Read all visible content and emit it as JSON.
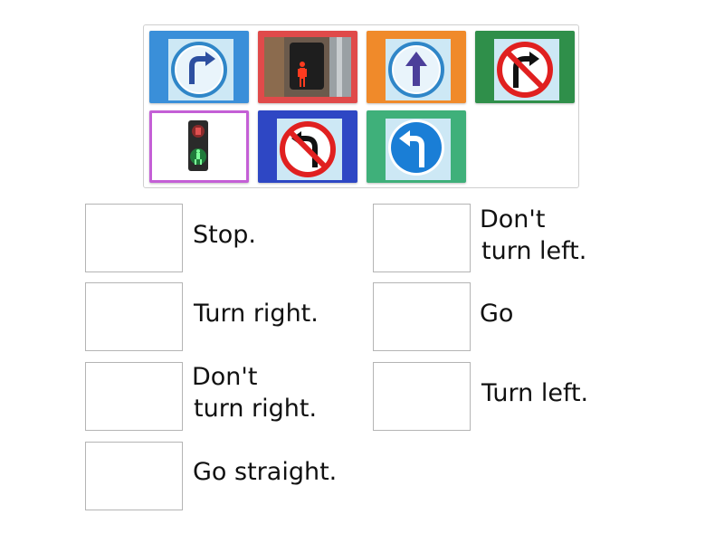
{
  "tiles": [
    {
      "id": "turn-right",
      "icon": "turn-right-sign-icon",
      "border": "#3a8fd9"
    },
    {
      "id": "red-pedestrian",
      "icon": "red-pedestrian-light-icon",
      "border": "#e04a4a"
    },
    {
      "id": "go-straight",
      "icon": "go-straight-sign-icon",
      "border": "#f08a2a"
    },
    {
      "id": "no-right-turn",
      "icon": "no-right-turn-sign-icon",
      "border": "#2f8f4a"
    },
    {
      "id": "green-pedestrian",
      "icon": "green-pedestrian-light-icon",
      "border": "#c45fd6"
    },
    {
      "id": "no-left-turn",
      "icon": "no-left-turn-sign-icon",
      "border": "#2e47c4"
    },
    {
      "id": "turn-left",
      "icon": "turn-left-sign-icon",
      "border": "#3fb07a"
    }
  ],
  "items": [
    {
      "label": "Stop."
    },
    {
      "label_line1": "Don't",
      "label_line2": "turn left."
    },
    {
      "label": "Turn right."
    },
    {
      "label": "Go"
    },
    {
      "label_line1": "Don't",
      "label_line2": "turn right."
    },
    {
      "label": "Turn left."
    },
    {
      "label": "Go straight."
    }
  ]
}
